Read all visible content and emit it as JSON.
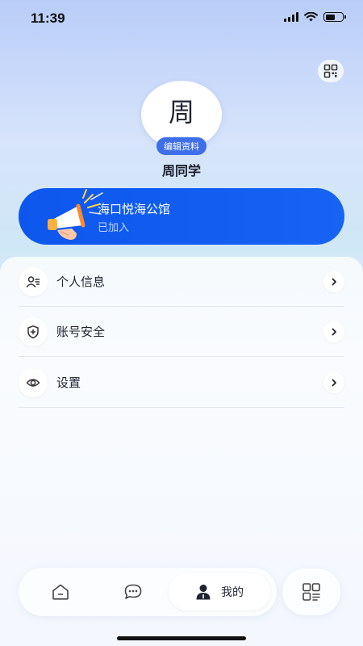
{
  "status_bar": {
    "time": "11:39"
  },
  "profile": {
    "avatar_char": "周",
    "edit_label": "编辑资料",
    "name": "周同学"
  },
  "organization": {
    "name": "海口悦海公馆",
    "status": "已加入",
    "icon": "megaphone-icon"
  },
  "menu": {
    "items": [
      {
        "label": "个人信息",
        "icon": "person-list-icon"
      },
      {
        "label": "账号安全",
        "icon": "shield-plus-icon"
      },
      {
        "label": "设置",
        "icon": "eye-settings-icon"
      }
    ]
  },
  "tabbar": {
    "home_icon": "home-icon",
    "chat_icon": "chat-bubble-icon",
    "mine_label": "我的",
    "apps_icon": "app-grid-icon"
  },
  "colors": {
    "accent": "#1763f2",
    "badge": "#3f6fe8"
  }
}
